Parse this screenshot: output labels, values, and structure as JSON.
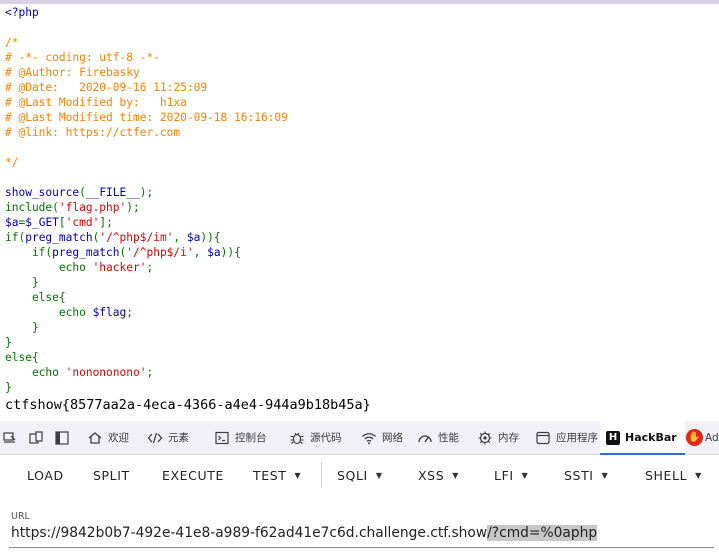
{
  "source": {
    "lines": [
      [
        {
          "t": "<?php",
          "c": "b"
        }
      ],
      [],
      [
        {
          "t": "/*",
          "c": "c"
        }
      ],
      [
        {
          "t": "# -*- coding: utf-8 -*-",
          "c": "c"
        }
      ],
      [
        {
          "t": "# @Author: Firebasky",
          "c": "c"
        }
      ],
      [
        {
          "t": "# @Date:   2020-09-16 11:25:09",
          "c": "c"
        }
      ],
      [
        {
          "t": "# @Last Modified by:   h1xa",
          "c": "c"
        }
      ],
      [
        {
          "t": "# @Last Modified time: 2020-09-18 16:16:09",
          "c": "c"
        }
      ],
      [
        {
          "t": "# @link: https://ctfer.com",
          "c": "c"
        }
      ],
      [],
      [
        {
          "t": "*/",
          "c": "c"
        }
      ],
      [],
      [
        {
          "t": "show_source",
          "c": "b"
        },
        {
          "t": "(",
          "c": "g"
        },
        {
          "t": "__FILE__",
          "c": "b"
        },
        {
          "t": ");",
          "c": "g"
        }
      ],
      [
        {
          "t": "include(",
          "c": "g"
        },
        {
          "t": "'flag.php'",
          "c": "s"
        },
        {
          "t": ");",
          "c": "g"
        }
      ],
      [
        {
          "t": "$a",
          "c": "b"
        },
        {
          "t": "=",
          "c": "g"
        },
        {
          "t": "$_GET",
          "c": "b"
        },
        {
          "t": "[",
          "c": "g"
        },
        {
          "t": "'cmd'",
          "c": "s"
        },
        {
          "t": "];",
          "c": "g"
        }
      ],
      [
        {
          "t": "if(",
          "c": "g"
        },
        {
          "t": "preg_match",
          "c": "b"
        },
        {
          "t": "(",
          "c": "g"
        },
        {
          "t": "'/^php$/im'",
          "c": "s"
        },
        {
          "t": ", ",
          "c": "g"
        },
        {
          "t": "$a",
          "c": "b"
        },
        {
          "t": ")){",
          "c": "g"
        }
      ],
      [
        {
          "t": "    if(",
          "c": "g"
        },
        {
          "t": "preg_match",
          "c": "b"
        },
        {
          "t": "(",
          "c": "g"
        },
        {
          "t": "'/^php$/i'",
          "c": "s"
        },
        {
          "t": ", ",
          "c": "g"
        },
        {
          "t": "$a",
          "c": "b"
        },
        {
          "t": ")){",
          "c": "g"
        }
      ],
      [
        {
          "t": "        echo ",
          "c": "g"
        },
        {
          "t": "'hacker'",
          "c": "s"
        },
        {
          "t": ";",
          "c": "g"
        }
      ],
      [
        {
          "t": "    }",
          "c": "g"
        }
      ],
      [
        {
          "t": "    else{",
          "c": "g"
        }
      ],
      [
        {
          "t": "        echo ",
          "c": "g"
        },
        {
          "t": "$flag",
          "c": "b"
        },
        {
          "t": ";",
          "c": "g"
        }
      ],
      [
        {
          "t": "    }",
          "c": "g"
        }
      ],
      [
        {
          "t": "}",
          "c": "g"
        }
      ],
      [
        {
          "t": "else{",
          "c": "g"
        }
      ],
      [
        {
          "t": "    echo ",
          "c": "g"
        },
        {
          "t": "'nonononono'",
          "c": "s"
        },
        {
          "t": ";",
          "c": "g"
        }
      ],
      [
        {
          "t": "}",
          "c": "g"
        }
      ]
    ],
    "output": "ctfshow{8577aa2a-4eca-4366-a4e4-944a9b18b45a}"
  },
  "devtools": {
    "tabs": [
      {
        "label": "欢迎",
        "icon": "home-icon"
      },
      {
        "label": "元素",
        "icon": "code-brackets-icon"
      },
      {
        "label": "控制台",
        "icon": "console-icon"
      },
      {
        "label": "源代码",
        "icon": "bug-icon"
      },
      {
        "label": "网络",
        "icon": "wifi-icon"
      },
      {
        "label": "性能",
        "icon": "gauge-icon"
      },
      {
        "label": "内存",
        "icon": "chip-icon"
      },
      {
        "label": "应用程序",
        "icon": "app-window-icon"
      },
      {
        "label": "HackBar",
        "icon": "hackbar-icon",
        "active": true
      },
      {
        "label": "Ad",
        "icon": "adblock-icon"
      }
    ]
  },
  "hackbar": {
    "buttons": [
      {
        "label": "LOAD",
        "dropdown": false
      },
      {
        "label": "SPLIT",
        "dropdown": false
      },
      {
        "label": "EXECUTE",
        "dropdown": false
      },
      {
        "label": "TEST",
        "dropdown": true
      },
      {
        "label": "SQLI",
        "dropdown": true
      },
      {
        "label": "XSS",
        "dropdown": true
      },
      {
        "label": "LFI",
        "dropdown": true
      },
      {
        "label": "SSTI",
        "dropdown": true
      },
      {
        "label": "SHELL",
        "dropdown": true
      }
    ],
    "url_label": "URL",
    "url_base": "https://9842b0b7-492e-41e8-a989-f62ad41e7c6d.challenge.ctf.show",
    "url_selected": "/?cmd=%0aphp"
  }
}
